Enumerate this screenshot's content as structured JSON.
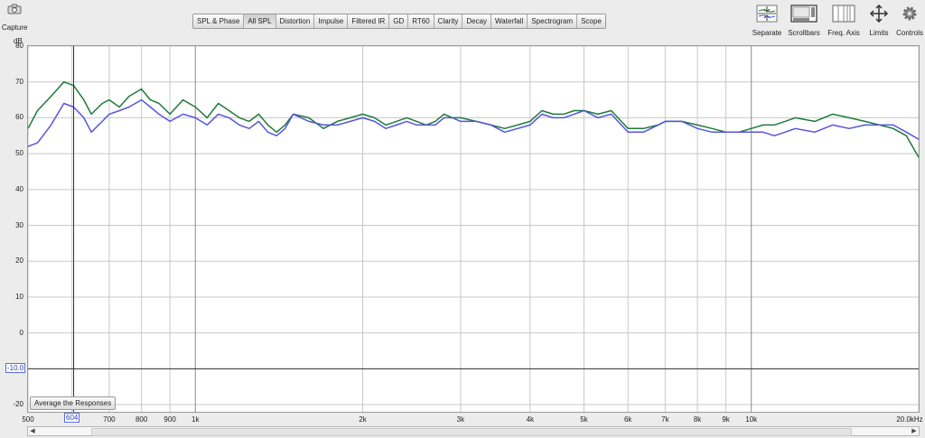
{
  "toolbar": {
    "capture_label": "Capture",
    "tabs": [
      "SPL & Phase",
      "All SPL",
      "Distortion",
      "Impulse",
      "Filtered IR",
      "GD",
      "RT60",
      "Clarity",
      "Decay",
      "Waterfall",
      "Spectrogram",
      "Scope"
    ],
    "active_tab": "All SPL",
    "right_buttons": {
      "separate": "Separate",
      "scrollbars": "Scrollbars",
      "freq_axis": "Freq. Axis",
      "limits": "Limits",
      "controls": "Controls"
    }
  },
  "plot": {
    "y_unit": "dB",
    "average_button": "Average the Responses",
    "cursor_y_readout": "-10.0",
    "cursor_x_readout": "604",
    "colors": {
      "background": "#ffffff",
      "grid": "#c8c8c8",
      "series1": "#1f7a3a",
      "series2": "#5555dd",
      "cursor": "#333333"
    }
  },
  "chart_data": {
    "type": "line",
    "x_scale": "log",
    "xlim": [
      500,
      20000
    ],
    "ylim": [
      -22,
      80
    ],
    "ylabel": "dB",
    "y_ticks": [
      80,
      70,
      60,
      50,
      40,
      30,
      20,
      10,
      0,
      -20
    ],
    "x_ticks": [
      {
        "v": 500,
        "label": "500"
      },
      {
        "v": 700,
        "label": "700"
      },
      {
        "v": 800,
        "label": "800"
      },
      {
        "v": 900,
        "label": "900"
      },
      {
        "v": 1000,
        "label": "1k"
      },
      {
        "v": 2000,
        "label": "2k"
      },
      {
        "v": 3000,
        "label": "3k"
      },
      {
        "v": 4000,
        "label": "4k"
      },
      {
        "v": 5000,
        "label": "5k"
      },
      {
        "v": 6000,
        "label": "6k"
      },
      {
        "v": 7000,
        "label": "7k"
      },
      {
        "v": 8000,
        "label": "8k"
      },
      {
        "v": 9000,
        "label": "9k"
      },
      {
        "v": 10000,
        "label": "10k"
      },
      {
        "v": 20000,
        "label": "20.0kHz"
      }
    ],
    "grid_x": [
      500,
      600,
      700,
      800,
      900,
      1000,
      2000,
      3000,
      4000,
      5000,
      6000,
      7000,
      8000,
      9000,
      10000,
      20000
    ],
    "cursor": {
      "x": 604,
      "y": -10
    },
    "grid": true,
    "series": [
      {
        "color": "#1f7a3a",
        "x": [
          500,
          520,
          550,
          580,
          604,
          630,
          650,
          680,
          700,
          730,
          760,
          800,
          830,
          860,
          900,
          950,
          1000,
          1050,
          1100,
          1150,
          1200,
          1250,
          1300,
          1350,
          1400,
          1450,
          1500,
          1600,
          1700,
          1800,
          1900,
          2000,
          2100,
          2200,
          2300,
          2400,
          2500,
          2600,
          2700,
          2800,
          2900,
          3000,
          3200,
          3400,
          3600,
          3800,
          4000,
          4200,
          4400,
          4600,
          4800,
          5000,
          5300,
          5600,
          6000,
          6400,
          6800,
          7000,
          7500,
          8000,
          8500,
          9000,
          9500,
          10000,
          10500,
          11000,
          11500,
          12000,
          13000,
          14000,
          15000,
          16000,
          17000,
          18000,
          19000,
          20000
        ],
        "y": [
          57,
          62,
          66,
          70,
          69,
          65,
          61,
          64,
          65,
          63,
          66,
          68,
          65,
          64,
          61,
          65,
          63,
          60,
          64,
          62,
          60,
          59,
          61,
          58,
          56,
          58,
          61,
          60,
          57,
          59,
          60,
          61,
          60,
          58,
          59,
          60,
          59,
          58,
          59,
          61,
          60,
          60,
          59,
          58,
          57,
          58,
          59,
          62,
          61,
          61,
          62,
          62,
          61,
          62,
          57,
          57,
          58,
          59,
          59,
          58,
          57,
          56,
          56,
          57,
          58,
          58,
          59,
          60,
          59,
          61,
          60,
          59,
          58,
          57,
          55,
          49
        ]
      },
      {
        "color": "#5555dd",
        "x": [
          500,
          520,
          550,
          580,
          604,
          630,
          650,
          680,
          700,
          730,
          760,
          800,
          830,
          860,
          900,
          950,
          1000,
          1050,
          1100,
          1150,
          1200,
          1250,
          1300,
          1350,
          1400,
          1450,
          1500,
          1600,
          1700,
          1800,
          1900,
          2000,
          2100,
          2200,
          2300,
          2400,
          2500,
          2600,
          2700,
          2800,
          2900,
          3000,
          3200,
          3400,
          3600,
          3800,
          4000,
          4200,
          4400,
          4600,
          4800,
          5000,
          5300,
          5600,
          6000,
          6400,
          6800,
          7000,
          7500,
          8000,
          8500,
          9000,
          9500,
          10000,
          10500,
          11000,
          11500,
          12000,
          13000,
          14000,
          15000,
          16000,
          17000,
          18000,
          19000,
          20000
        ],
        "y": [
          52,
          53,
          58,
          64,
          63,
          60,
          56,
          59,
          61,
          62,
          63,
          65,
          63,
          61,
          59,
          61,
          60,
          58,
          61,
          60,
          58,
          57,
          59,
          56,
          55,
          57,
          61,
          59,
          58,
          58,
          59,
          60,
          59,
          57,
          58,
          59,
          58,
          58,
          58,
          60,
          60,
          59,
          59,
          58,
          56,
          57,
          58,
          61,
          60,
          60,
          61,
          62,
          60,
          61,
          56,
          56,
          58,
          59,
          59,
          57,
          56,
          56,
          56,
          56,
          56,
          55,
          56,
          57,
          56,
          58,
          57,
          58,
          58,
          58,
          56,
          54
        ]
      }
    ]
  }
}
